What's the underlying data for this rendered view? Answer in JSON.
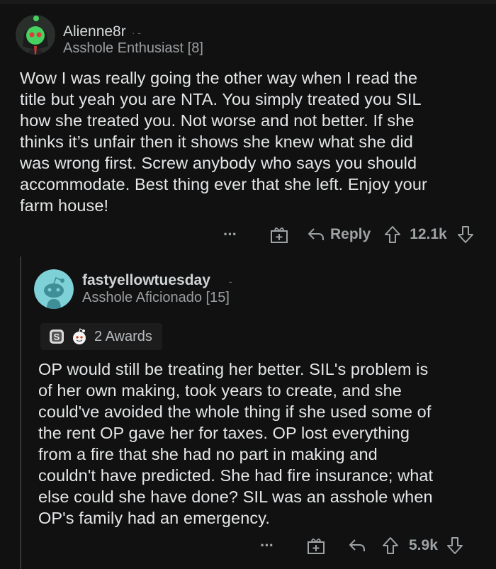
{
  "comments": [
    {
      "username": "Alienne8r",
      "flair": "Asshole Enthusiast [8]",
      "lines": [
        "Wow I was really going the other way when I read the",
        "title but yeah you are NTA. You simply treated you SIL",
        "how she treated you. Not worse and not better. If she",
        "thinks it’s unfair then it shows she knew what she did",
        "was wrong first. Screw anybody who says you should",
        "accommodate. Best thing ever that she left. Enjoy your",
        "farm house!"
      ],
      "more_label": "···",
      "reply_label": "Reply",
      "score": "12.1k",
      "icons": [
        "more-icon",
        "award-gift-icon",
        "reply-arrow-icon",
        "upvote-icon",
        "downvote-icon"
      ]
    },
    {
      "username": "fastyellowtuesday",
      "flair": "Asshole Aficionado [15]",
      "awards_label": "2 Awards",
      "lines": [
        "OP would still be treating her better. SIL's problem is",
        "of her own making, took years to create, and she",
        "could've avoided the whole thing if she used some of",
        "the rent OP gave her for taxes. OP lost everything",
        "from a fire that she had no part in making and",
        "couldn't have predicted. She had fire insurance; what",
        "else could she have done? SIL was an asshole when",
        "OP's family had an emergency."
      ],
      "more_label": "···",
      "score": "5.9k",
      "icons": [
        "more-icon",
        "award-gift-icon",
        "reply-arrow-icon",
        "upvote-icon",
        "downvote-icon"
      ]
    }
  ],
  "colors": {
    "background": "#111111",
    "text": "#e4e6e8",
    "muted": "#9b9fa2",
    "thread_line": "#343536",
    "snoo_avatar": "#7fd1d8"
  }
}
